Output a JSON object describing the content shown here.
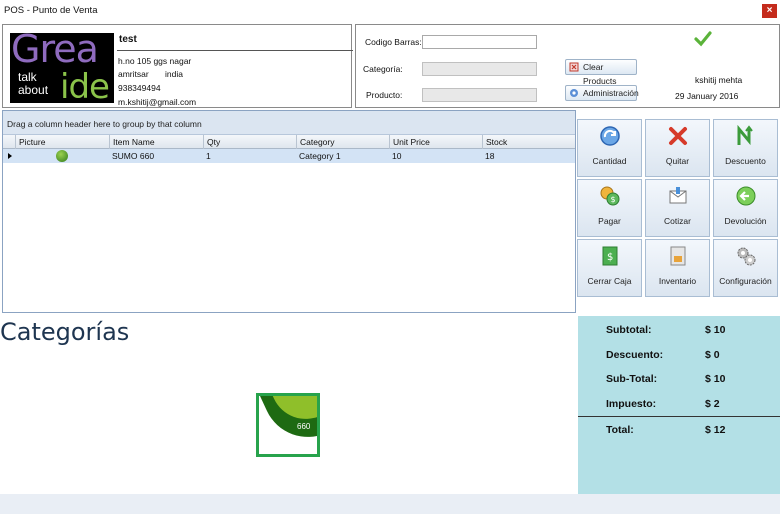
{
  "window": {
    "title": "POS - Punto de Venta",
    "close_glyph": "×"
  },
  "company": {
    "logo_line1": "Grea",
    "logo_line2a": "talk",
    "logo_line2b": "about",
    "logo_line3": "ide",
    "name": "test",
    "address": "h.no 105 ggs nagar",
    "city": "amritsar",
    "country": "india",
    "phone": "938349494",
    "email": "m.kshitij@gmail.com"
  },
  "scanner": {
    "barcode_label": "Codigo Barras:",
    "barcode_value": "",
    "category_label": "Categoría:",
    "category_value": "",
    "product_label": "Producto:",
    "product_value": "",
    "clear_label": "Clear Products",
    "admin_label": "Administración",
    "user": "kshitij mehta",
    "date": "29 January 2016"
  },
  "grid": {
    "group_hint": "Drag a column header here to group by that column",
    "columns": [
      "Picture",
      "Item Name",
      "Qty",
      "Category",
      "Unit Price",
      "Stock"
    ],
    "rows": [
      {
        "item": "SUMO 660",
        "qty": "1",
        "category": "Category 1",
        "price": "10",
        "stock": "18"
      }
    ]
  },
  "actions": {
    "cantidad": "Cantidad",
    "quitar": "Quitar",
    "descuento": "Descuento",
    "pagar": "Pagar",
    "cotizar": "Cotizar",
    "devolucion": "Devolución",
    "cerrar_caja": "Cerrar Caja",
    "inventario": "Inventario",
    "configuracion": "Configuración"
  },
  "categories": {
    "title": "Categorías",
    "tile_label": "660"
  },
  "totals": {
    "subtotal_label": "Subtotal:",
    "subtotal": "$ 10",
    "descuento_label": "Descuento:",
    "descuento": "$ 0",
    "subtotal2_label": "Sub-Total:",
    "subtotal2": "$ 10",
    "impuesto_label": "Impuesto:",
    "impuesto": "$ 2",
    "total_label": "Total:",
    "total": "$ 12"
  },
  "colors": {
    "accent": "#27a34c",
    "totals_bg": "#b3e0e6",
    "close": "#c42b1c"
  }
}
